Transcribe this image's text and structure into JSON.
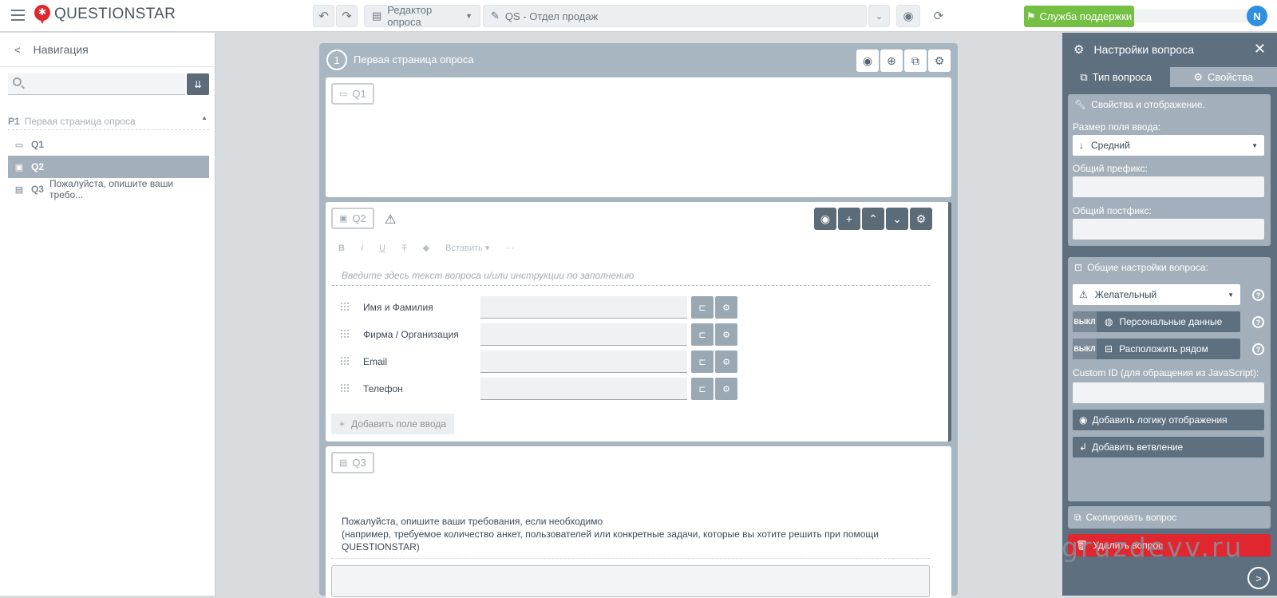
{
  "app": {
    "brand": "QUESTIONSTAR",
    "user_initial": "N"
  },
  "toolbar": {
    "editor_label": "Редактор опроса",
    "survey_label": "QS - Отдел продаж",
    "support_label": "Служба поддержки"
  },
  "nav": {
    "title": "Навигация",
    "page": {
      "num": "P1",
      "title": "Первая страница опроса"
    },
    "items": [
      {
        "id": "Q1",
        "text": ""
      },
      {
        "id": "Q2",
        "text": ""
      },
      {
        "id": "Q3",
        "text": "Пожалуйста, опишите ваши требо..."
      }
    ]
  },
  "page": {
    "number": "1",
    "title": "Первая страница опроса",
    "q1": {
      "label": "Q1"
    },
    "q2": {
      "label": "Q2",
      "format": {
        "bold": "B",
        "italic": "I",
        "underline": "U",
        "strike": "T",
        "insert": "Вставить",
        "more": "···"
      },
      "placeholder": "Введите здесь текст вопроса и/или инструкции по заполнению",
      "fields": [
        "Имя и Фамилия",
        "Фирма / Организация",
        "Email",
        "Телефон"
      ],
      "add_field": "Добавить поле ввода"
    },
    "q3": {
      "label": "Q3",
      "line1": "Пожалуйста, опишите ваши требования, если необходимо",
      "line2": "(например, требуемое количество анкет, пользователей или конкретные задачи, которые вы хотите решить при помощи",
      "line3": "QUESTIONSTAR)"
    }
  },
  "settings": {
    "title": "Настройки вопроса",
    "tabs": [
      "Тип вопроса",
      "Свойства"
    ],
    "props": {
      "title": "Свойства и отображение.",
      "size_label": "Размер поля ввода:",
      "size_value": "Средний",
      "prefix_label": "Общий префикс:",
      "postfix_label": "Общий постфикс:"
    },
    "general": {
      "title": "Общие настройки вопроса:",
      "required_value": "Желательный",
      "toggle_off": "ВЫКЛ",
      "personal": "Персональные данные",
      "side": "Расположить рядом",
      "custom_id_label": "Custom ID (для обращения из JavaScript):",
      "logic_btn": "Добавить логику отображения",
      "branch_btn": "Добавить ветвление"
    },
    "copy": "Скопировать вопрос",
    "delete": "Удалить вопрос"
  },
  "watermark": "gruzdevv.ru",
  "colors": {
    "accent": "#74c043",
    "danger": "#e0262e",
    "panel": "#5e7080",
    "page": "#a8b6c1"
  }
}
